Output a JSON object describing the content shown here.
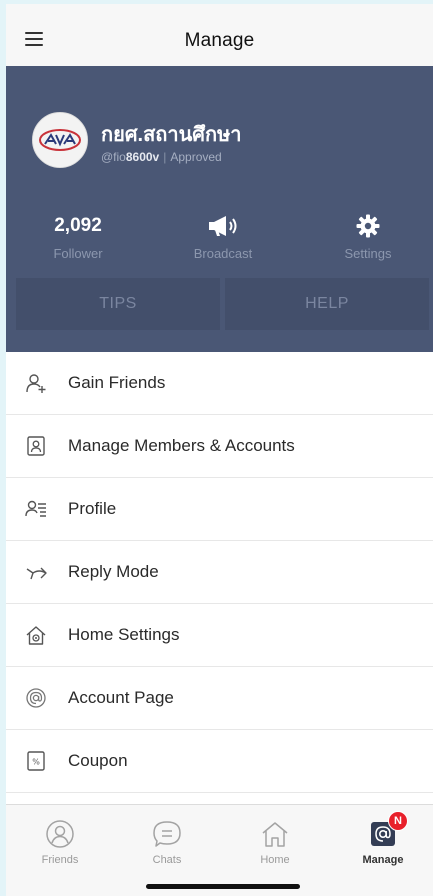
{
  "topbar": {
    "title": "Manage"
  },
  "account": {
    "name": "กยศ.สถานศึกษา",
    "id_prefix": "@fio",
    "id_bold": "8600v",
    "status": "Approved"
  },
  "stats": {
    "follower_value": "2,092",
    "follower_label": "Follower",
    "broadcast_label": "Broadcast",
    "settings_label": "Settings"
  },
  "header_buttons": {
    "tips": "TIPS",
    "help": "HELP"
  },
  "menu": [
    {
      "label": "Gain Friends",
      "icon": "add-friend-icon"
    },
    {
      "label": "Manage Members & Accounts",
      "icon": "member-card-icon"
    },
    {
      "label": "Profile",
      "icon": "profile-icon"
    },
    {
      "label": "Reply Mode",
      "icon": "reply-arrow-icon"
    },
    {
      "label": "Home Settings",
      "icon": "home-gear-icon"
    },
    {
      "label": "Account Page",
      "icon": "at-sign-icon"
    },
    {
      "label": "Coupon",
      "icon": "coupon-icon"
    }
  ],
  "tabs": {
    "friends": "Friends",
    "chats": "Chats",
    "home": "Home",
    "manage": "Manage",
    "badge": "N"
  },
  "colors": {
    "header_bg": "#4a5775",
    "header_button_bg": "#434f6b",
    "badge": "#e8202b"
  }
}
